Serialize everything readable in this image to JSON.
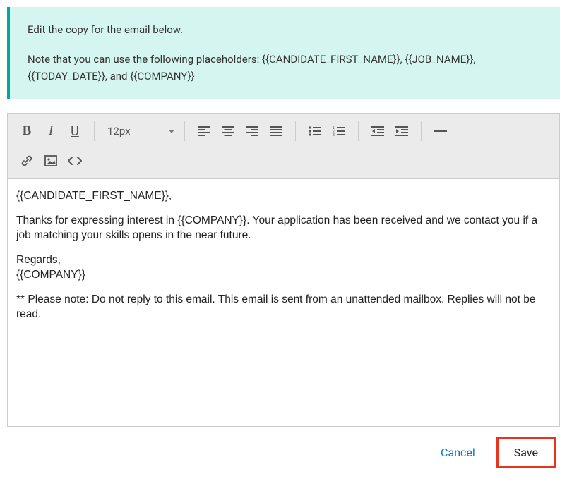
{
  "banner": {
    "line1": "Edit the copy for the email below.",
    "line2": "Note that you can use the following placeholders: {{CANDIDATE_FIRST_NAME}}, {{JOB_NAME}}, {{TODAY_DATE}}, and {{COMPANY}}"
  },
  "toolbar": {
    "font_size": "12px"
  },
  "email_body": {
    "p1": "{{CANDIDATE_FIRST_NAME}},",
    "p2": "Thanks for expressing interest in {{COMPANY}}. Your application has been received and we contact you if a job matching your skills opens in the near future.",
    "p3a": "Regards,",
    "p3b": "{{COMPANY}}",
    "p4": "** Please note: Do not reply to this email. This email is sent from an unattended mailbox. Replies will not be read."
  },
  "actions": {
    "cancel": "Cancel",
    "save": "Save"
  }
}
